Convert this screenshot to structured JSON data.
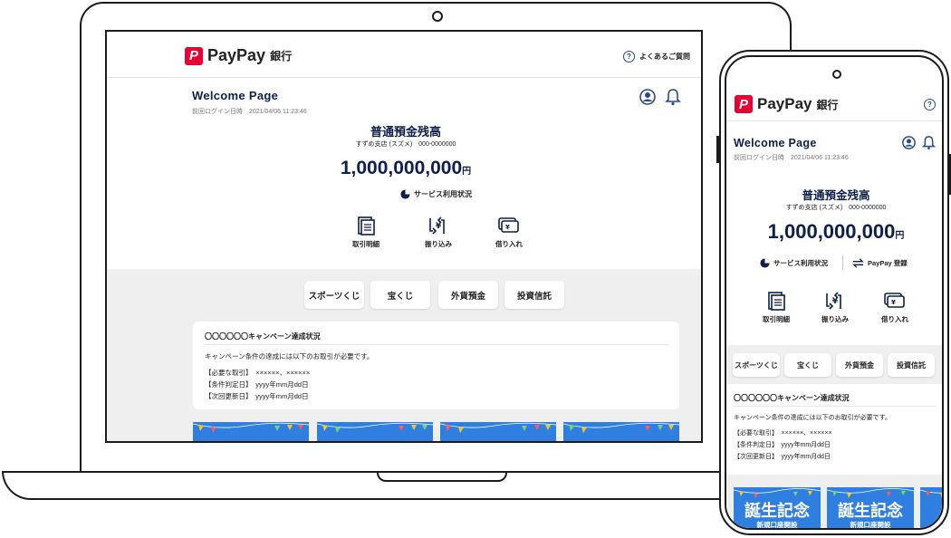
{
  "brand": {
    "name": "PayPay",
    "sub": "銀行",
    "mark": "P"
  },
  "desktop": {
    "help": "よくあるご質問",
    "welcome": "Welcome Page",
    "last_login": "前回ログイン日時　2021/04/06 11:23:46",
    "balance_title": "普通預金残高",
    "branch": "すずめ支店 (スズメ)　000-0000000",
    "balance": "1,000,000,000",
    "unit": "円",
    "service": "サービス利用状況",
    "actions": [
      "取引明細",
      "振り込み",
      "借り入れ"
    ],
    "pills": [
      "スポーツくじ",
      "宝くじ",
      "外貨預金",
      "投資信託"
    ],
    "campaign": {
      "title": "〇〇〇〇〇〇キャンペーン達成状況",
      "desc": "キャンペーン条件の達成には以下のお取引が必要です。",
      "lines": [
        "【必要な取引】　××××××、××××××",
        "【条件判定日】　yyyy年mm月dd日",
        "【次回更新日】　yyyy年mm月dd日"
      ]
    }
  },
  "mobile": {
    "welcome": "Welcome Page",
    "last_login": "前回ログイン日時　2021/04/06 11:23:46",
    "balance_title": "普通預金残高",
    "branch": "すずめ支店 (スズメ)　000-0000000",
    "balance": "1,000,000,000",
    "unit": "円",
    "service": "サービス利用状況",
    "paypay_reg": "PayPay 登録",
    "actions": [
      "取引明細",
      "振り込み",
      "借り入れ"
    ],
    "pills": [
      "スポーツくじ",
      "宝くじ",
      "外貨預金",
      "投資信託"
    ],
    "campaign": {
      "title": "〇〇〇〇〇〇キャンペーン達成状況",
      "desc": "キャンペーン条件の達成には以下のお取引が必要です。",
      "lines": [
        "【必要な取引】　××××××、××××××",
        "【条件判定日】　yyyy年mm月dd日",
        "【次回更新日】　yyyy年mm月dd日"
      ]
    },
    "banner_title": "誕生記念",
    "banner_sub": "新規口座開設"
  },
  "colors": {
    "accent": "#0d1f4a",
    "brand": "#e60033",
    "banner": "#2e7fe0",
    "band": "#efefef"
  }
}
